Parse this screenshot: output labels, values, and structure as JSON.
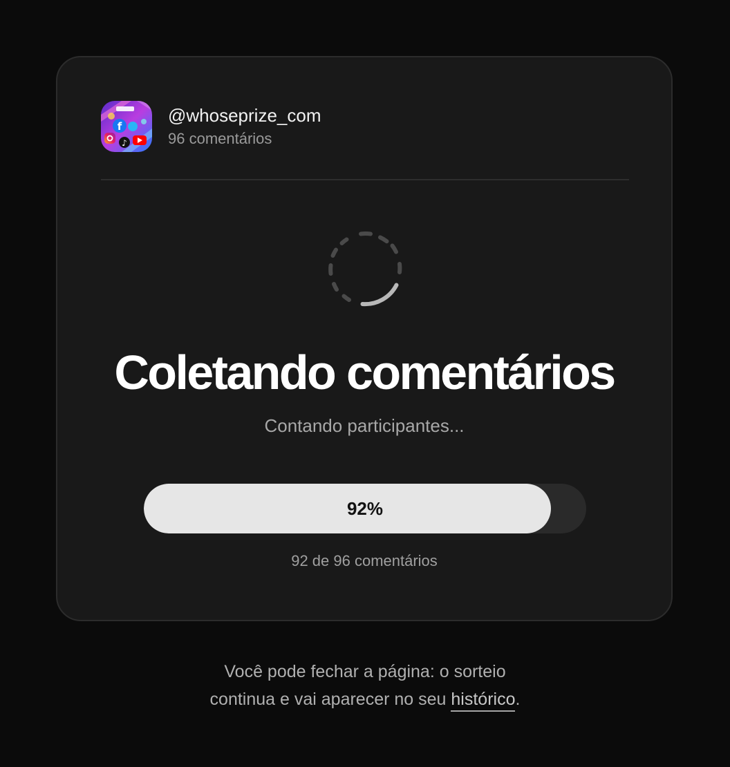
{
  "account": {
    "username": "@whoseprize_com",
    "comment_count": "96 comentários",
    "avatar_icon": "social-apps-collage-icon"
  },
  "loader": {
    "icon": "loading-spinner-icon"
  },
  "heading": "Coletando comentários",
  "status": "Contando participantes...",
  "progress": {
    "value": 0.92,
    "label": "92%",
    "caption": "92 de 96 comentários"
  },
  "footer": {
    "line1": "Você pode fechar a página: o sorteio",
    "line2_prefix": "continua e vai aparecer no seu ",
    "link": "histórico",
    "line2_suffix": "."
  },
  "colors": {
    "page_background": "#0b0b0b",
    "card_background": "#191919",
    "progress_fill": "#e6e6e6",
    "progress_track": "#2a2a2a"
  }
}
